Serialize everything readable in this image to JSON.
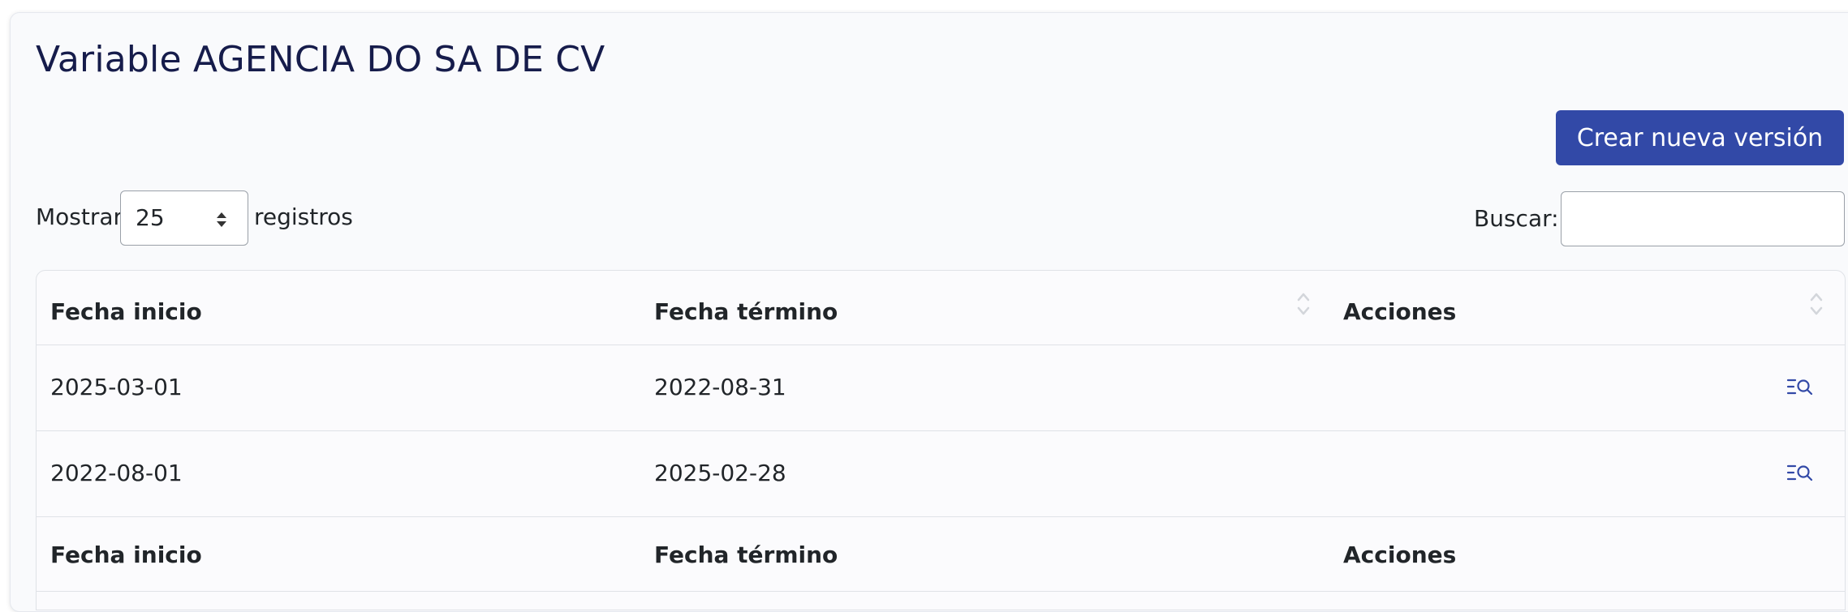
{
  "page": {
    "title": "Variable AGENCIA DO SA DE CV"
  },
  "toolbar": {
    "create_label": "Crear nueva versión"
  },
  "length_menu": {
    "prefix": "Mostrar",
    "value": "25",
    "suffix": "registros"
  },
  "search": {
    "label": "Buscar:",
    "value": "",
    "placeholder": ""
  },
  "table": {
    "columns": [
      "Fecha inicio",
      "Fecha término",
      "Acciones"
    ],
    "rows": [
      {
        "start": "2025-03-01",
        "end": "2022-08-31",
        "action_icon": "view-details-icon"
      },
      {
        "start": "2022-08-01",
        "end": "2025-02-28",
        "action_icon": "view-details-icon"
      }
    ],
    "footer": [
      "Fecha inicio",
      "Fecha término",
      "Acciones"
    ]
  },
  "colors": {
    "primary": "#3249a7",
    "title": "#161c4b",
    "icon": "#3249a7"
  }
}
